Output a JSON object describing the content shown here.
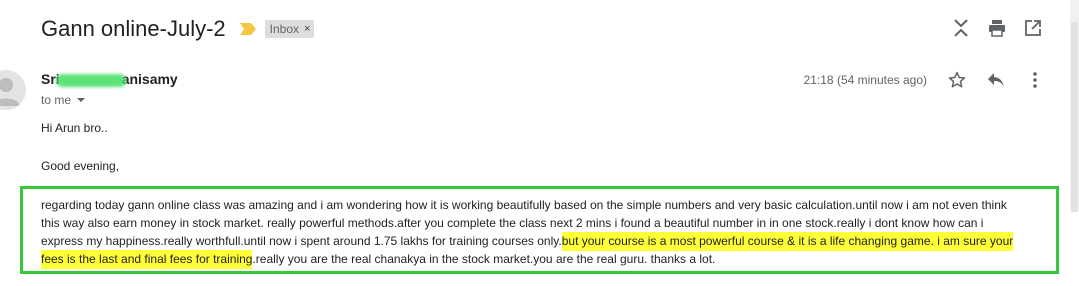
{
  "email": {
    "subject": "Gann online-July-2",
    "label": "Inbox",
    "label_remove": "×",
    "sender_prefix": "Sri",
    "sender_suffix": "anisamy",
    "recipient": "to me",
    "timestamp": "21:18 (54 minutes ago)",
    "greeting": "Hi Arun bro..",
    "salutation": "Good evening,",
    "body_part1": "regarding today gann online class was amazing and i am wondering how it is working beautifully  based on the simple numbers and very basic calculation.until now i am not even think this way also earn money in stock market. really powerful methods.after you complete the class next 2 mins i found a beautiful number in in one stock.really i dont know how can i express my happiness.really worthfull.until now i spent around 1.75 lakhs for training courses only.",
    "body_highlight": "but your course is a most powerful course & it is a life changing game. i am sure your fees is the last and final fees for training",
    "body_part2": ".really you are the real chanakya in the stock market.you are the real guru. thanks a lot."
  },
  "colors": {
    "highlight": "#ffff38",
    "box_border": "#35c83b",
    "importance": "#f4c542",
    "redaction": "#4be06a"
  },
  "icons": [
    "importance-marker-icon",
    "expand-collapse-icon",
    "print-icon",
    "open-in-new-window-icon",
    "star-icon",
    "reply-icon",
    "more-vertical-icon",
    "person-icon"
  ]
}
